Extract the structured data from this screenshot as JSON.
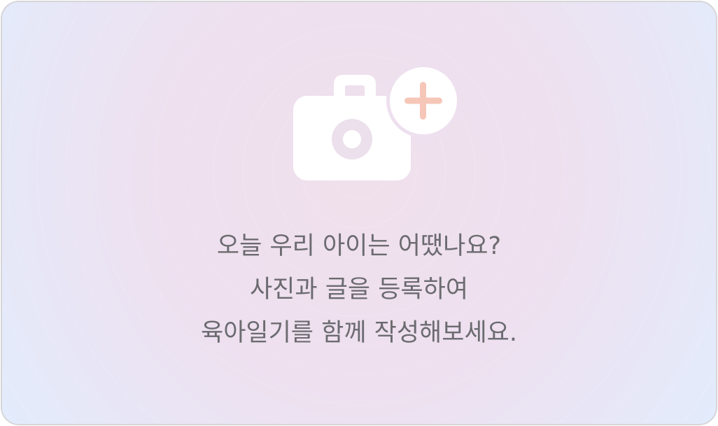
{
  "upload_card": {
    "message_lines": [
      "오늘 우리 아이는 어땠나요?",
      "사진과 글을 등록하여",
      "육아일기를 함께 작성해보세요."
    ],
    "icon": "camera-plus-icon"
  },
  "colors": {
    "text": "#6b6b70",
    "icon_fill": "#ffffff",
    "plus_accent": "#f6c6b8",
    "border": "#d6d6d9",
    "background_center": "#f0e0ec",
    "background_edge": "#e1edfd"
  }
}
